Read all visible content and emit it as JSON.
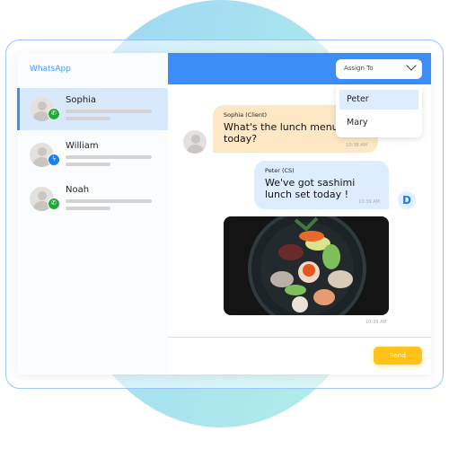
{
  "sidebar": {
    "title": "WhatsApp",
    "contacts": [
      {
        "name": "Sophia",
        "channel": "whatsapp-icon",
        "selected": true
      },
      {
        "name": "William",
        "channel": "messenger-icon",
        "selected": false
      },
      {
        "name": "Noah",
        "channel": "whatsapp-icon",
        "selected": false
      }
    ]
  },
  "header": {
    "assign_label": "Assign To",
    "options": [
      "Peter",
      "Mary"
    ],
    "highlighted": "Peter"
  },
  "messages": [
    {
      "sender": "Sophia (Client)",
      "text": "What's the lunch menu today?",
      "time": "10:38 AM"
    },
    {
      "sender": "Peter (CS)",
      "text": "We've got sashimi lunch set today !",
      "time": "10:39 AM",
      "avatar_letter": "D"
    },
    {
      "type": "image",
      "time": "10:39 AM"
    }
  ],
  "composer": {
    "send_label": "Send"
  },
  "colors": {
    "accent": "#3a8ef5",
    "send": "#ffc21a",
    "client_bubble": "#fde7c4",
    "agent_bubble": "#deedfd",
    "whatsapp": "#22a83a",
    "messenger": "#1a7ff0"
  }
}
